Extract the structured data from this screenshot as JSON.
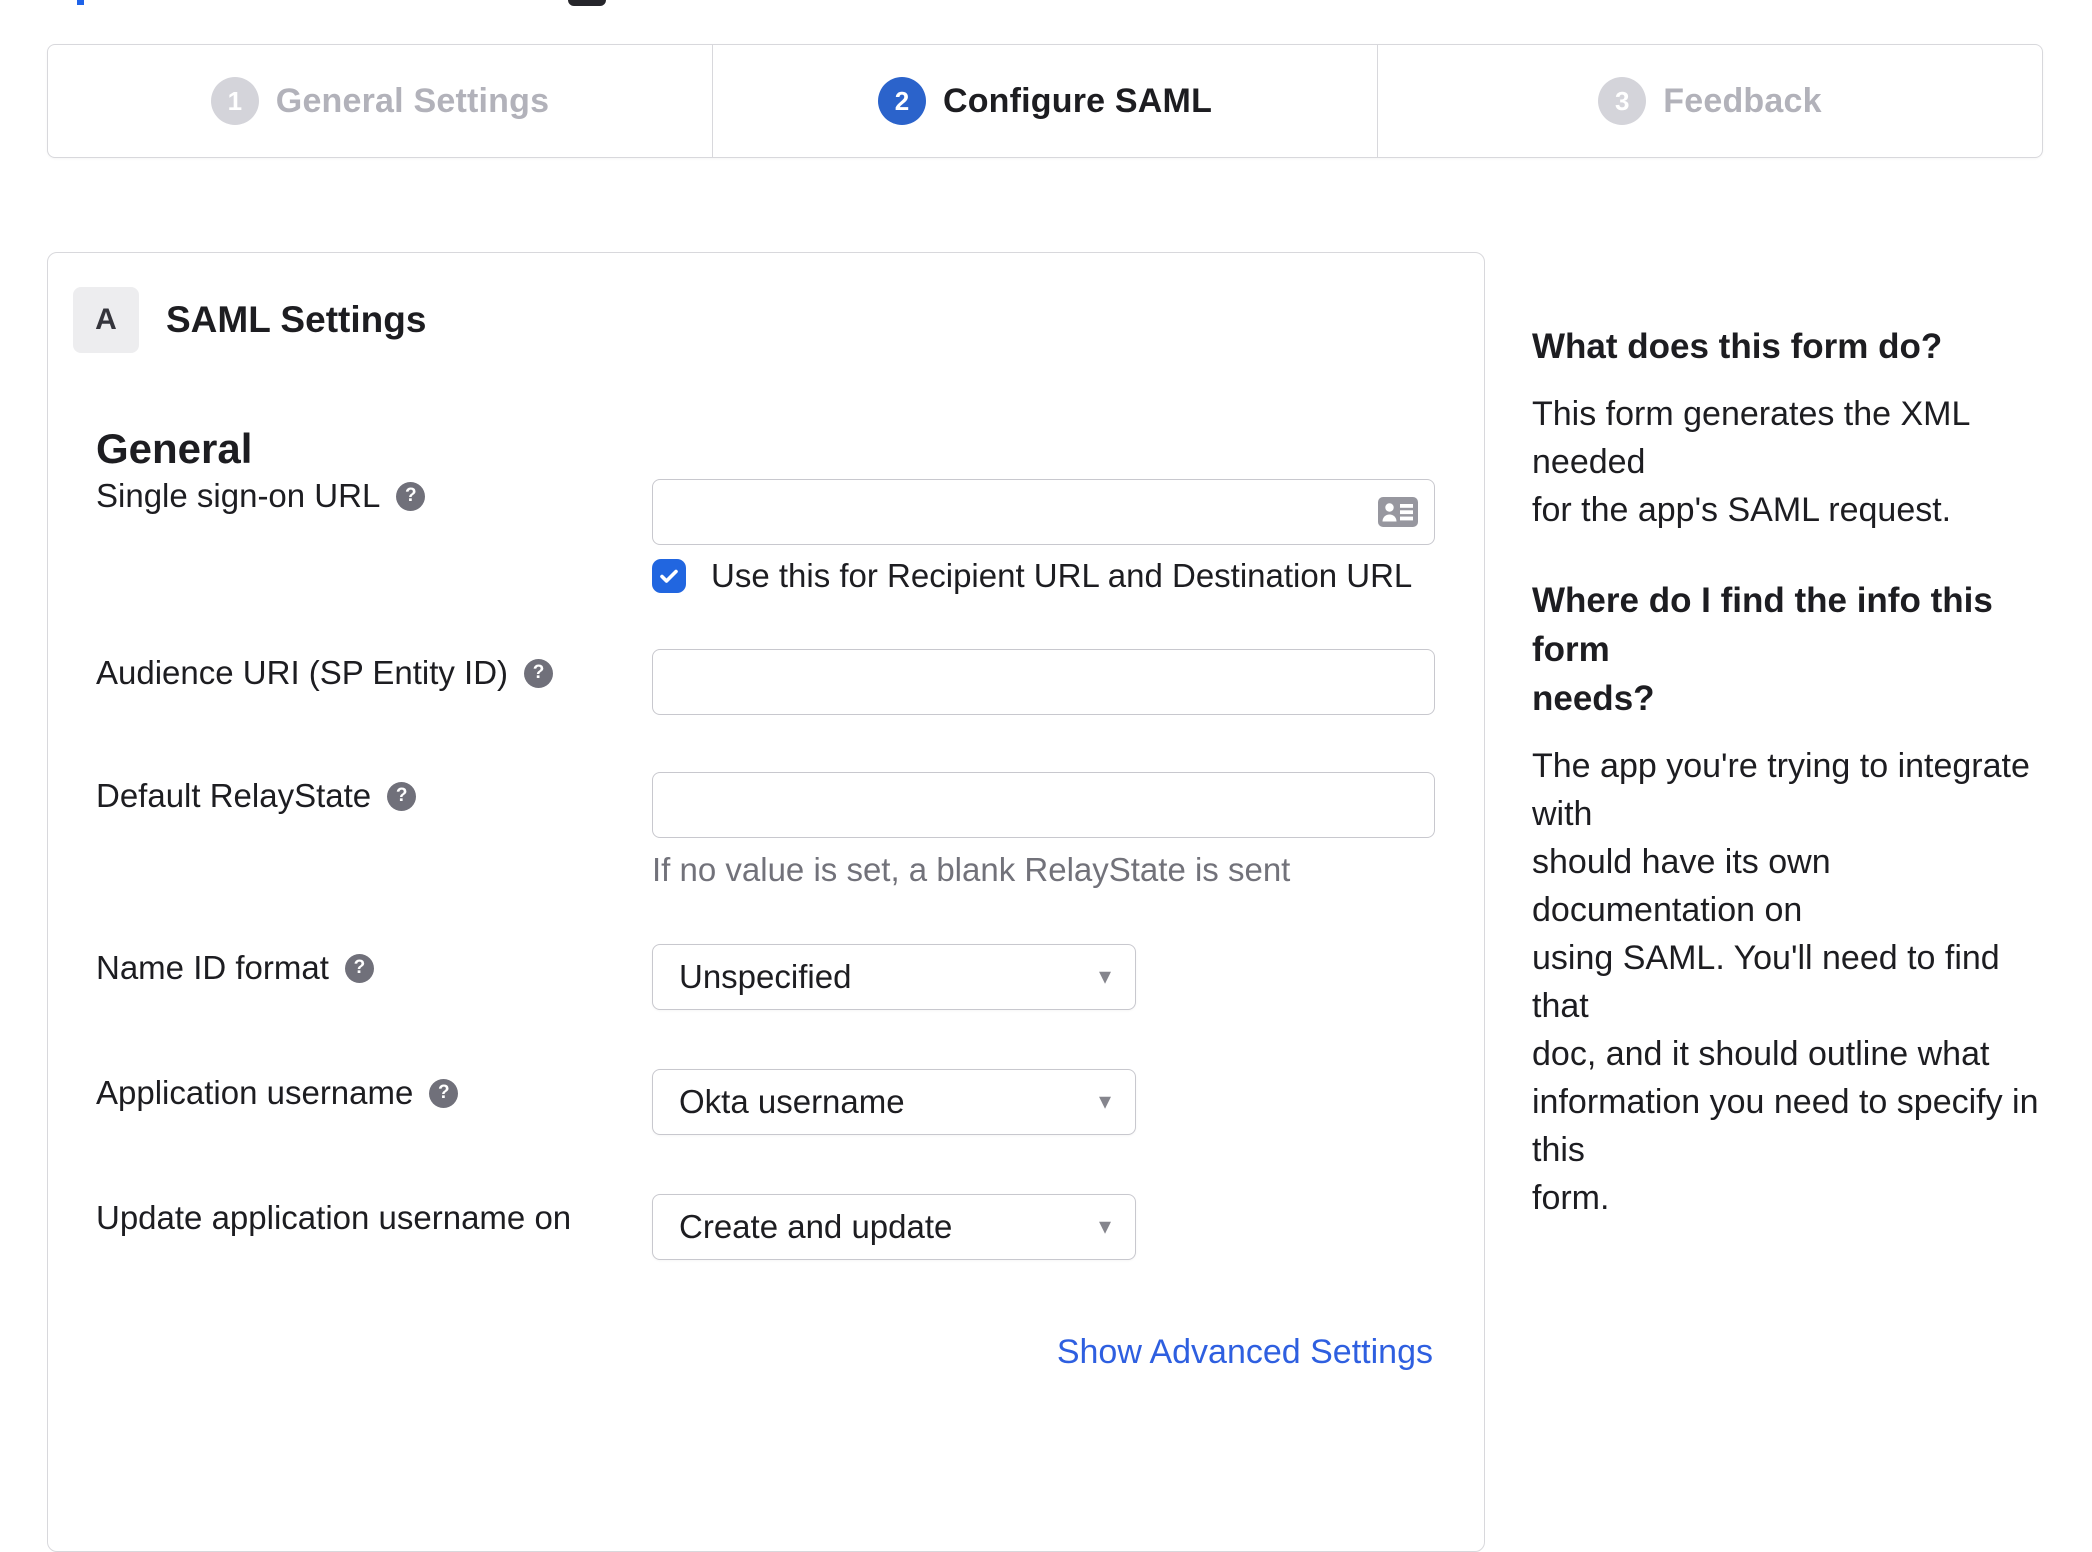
{
  "stepper": {
    "steps": [
      {
        "number": "1",
        "label": "General Settings",
        "state": "inactive"
      },
      {
        "number": "2",
        "label": "Configure SAML",
        "state": "active"
      },
      {
        "number": "3",
        "label": "Feedback",
        "state": "inactive"
      }
    ]
  },
  "panel": {
    "section_badge": "A",
    "section_title": "SAML Settings",
    "group_heading": "General",
    "fields": {
      "sso": {
        "label": "Single sign-on URL",
        "value": "",
        "checkbox_label": "Use this for Recipient URL and Destination URL",
        "checkbox_checked": true
      },
      "audience": {
        "label": "Audience URI (SP Entity ID)",
        "value": ""
      },
      "relay": {
        "label": "Default RelayState",
        "value": "",
        "hint": "If no value is set, a blank RelayState is sent"
      },
      "nameid": {
        "label": "Name ID format",
        "value": "Unspecified"
      },
      "appuser": {
        "label": "Application username",
        "value": "Okta username"
      },
      "update": {
        "label": "Update application username on",
        "value": "Create and update"
      }
    },
    "advanced_link": "Show Advanced Settings"
  },
  "sidebar": {
    "q1": "What does this form do?",
    "a1": "This form generates the XML needed\nfor the app's SAML request.",
    "q2": "Where do I find the info this form\nneeds?",
    "a2": "The app you're trying to integrate with\nshould have its own documentation on\nusing SAML. You'll need to find that\ndoc, and it should outline what\ninformation you need to specify in this\nform."
  },
  "icons": {
    "help_glyph": "?",
    "caret_glyph": "▾"
  },
  "colors": {
    "text": "#1d1d21",
    "muted_text": "#72727a",
    "inactive_step": "#b2b2ba",
    "active_step_circle": "#2b63cb",
    "checkbox_blue": "#2166e0",
    "link_blue": "#2e5fe0",
    "border": "#d8d8dc"
  }
}
